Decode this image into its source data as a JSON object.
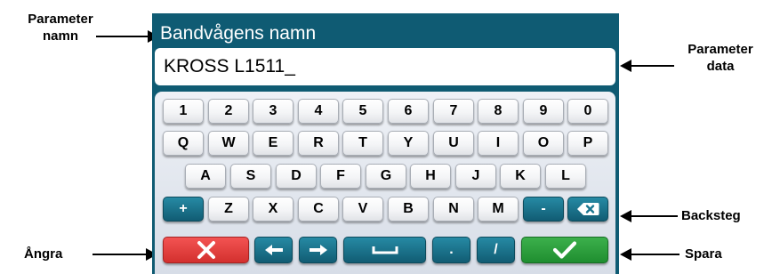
{
  "callouts": {
    "parameter_namn_line1": "Parameter",
    "parameter_namn_line2": "namn",
    "parameter_data_line1": "Parameter",
    "parameter_data_line2": "data",
    "backsteg": "Backsteg",
    "angra": "Ångra",
    "spara": "Spara"
  },
  "screen": {
    "parameter_name": "Bandvågens namn",
    "parameter_value": "KROSS L1511_"
  },
  "keyboard": {
    "row1": [
      "1",
      "2",
      "3",
      "4",
      "5",
      "6",
      "7",
      "8",
      "9",
      "0"
    ],
    "row2": [
      "Q",
      "W",
      "E",
      "R",
      "T",
      "Y",
      "U",
      "I",
      "O",
      "P"
    ],
    "row3": [
      "A",
      "S",
      "D",
      "F",
      "G",
      "H",
      "J",
      "K",
      "L"
    ],
    "row4": {
      "plus": "+",
      "letters": [
        "Z",
        "X",
        "C",
        "V",
        "B",
        "N",
        "M"
      ],
      "minus": "-"
    },
    "row5": {
      "dot": ".",
      "slash": "/"
    }
  },
  "icons": {
    "cancel": "x-icon",
    "left": "arrow-left-icon",
    "right": "arrow-right-icon",
    "space": "space-bar-icon",
    "confirm": "checkmark-icon",
    "backspace": "backspace-icon"
  },
  "colors": {
    "panel": "#0f5b73",
    "teal_key": "#1a7690",
    "cancel": "#e43f3e",
    "confirm": "#2a9c3b"
  }
}
